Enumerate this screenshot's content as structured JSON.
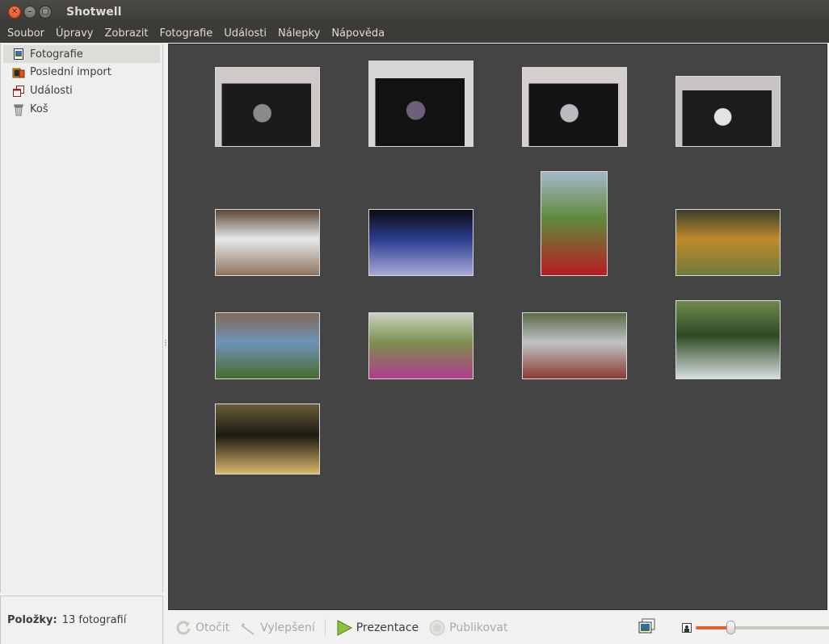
{
  "window": {
    "title": "Shotwell"
  },
  "menu": [
    "Soubor",
    "Úpravy",
    "Zobrazit",
    "Fotografie",
    "Události",
    "Nálepky",
    "Nápověda"
  ],
  "sidebar": {
    "items": [
      {
        "label": "Fotografie",
        "icon": "photos-icon",
        "selected": true
      },
      {
        "label": "Poslední import",
        "icon": "import-icon",
        "selected": false
      },
      {
        "label": "Události",
        "icon": "events-icon",
        "selected": false
      },
      {
        "label": "Koš",
        "icon": "trash-icon",
        "selected": false
      }
    ]
  },
  "status": {
    "label": "Položky:",
    "value": "13 fotografií"
  },
  "photos": [
    {
      "subject": "camera-front-lens",
      "palette": [
        "#cfcac7",
        "#1b1b1b",
        "#8a8a8a"
      ]
    },
    {
      "subject": "camera-wide-lens",
      "palette": [
        "#d8d6d4",
        "#121212",
        "#6e5f7a"
      ]
    },
    {
      "subject": "camera-zoom-lens",
      "palette": [
        "#d4cfcc",
        "#141414",
        "#b9bcc0"
      ]
    },
    {
      "subject": "camera-body-mount",
      "palette": [
        "#c9c4c4",
        "#1c1c1c",
        "#e3e3e3"
      ]
    },
    {
      "subject": "field-landscape",
      "palette": [
        "#e7e9ec",
        "#8e7560",
        "#5d4633"
      ]
    },
    {
      "subject": "dusk-sky",
      "palette": [
        "#2b3c8e",
        "#a7a9d6",
        "#0c0c12"
      ]
    },
    {
      "subject": "rosehip-bush",
      "palette": [
        "#5f8a3b",
        "#b91d24",
        "#a4b8c8"
      ]
    },
    {
      "subject": "autumn-shrub",
      "palette": [
        "#c08a2a",
        "#6f7b3a",
        "#3a3f2b"
      ]
    },
    {
      "subject": "plants-blue-sky",
      "palette": [
        "#6f93b8",
        "#4a6b2c",
        "#806a5a"
      ]
    },
    {
      "subject": "thistle-flower",
      "palette": [
        "#7c8f4d",
        "#b23c8f",
        "#c9d2c0"
      ]
    },
    {
      "subject": "rosehip-branch",
      "palette": [
        "#bfc4c6",
        "#8a3b30",
        "#5c6b47"
      ]
    },
    {
      "subject": "spruce-trees",
      "palette": [
        "#2f4a25",
        "#d6dde0",
        "#6f8a4c"
      ]
    },
    {
      "subject": "sun-through-trees",
      "palette": [
        "#1c1a12",
        "#d9b86a",
        "#6a5c3a"
      ]
    }
  ],
  "toolbar": {
    "rotate_label": "Otočit",
    "enhance_label": "Vylepšení",
    "slideshow_label": "Prezentace",
    "publish_label": "Publikovat",
    "zoom_level": 0.22
  }
}
